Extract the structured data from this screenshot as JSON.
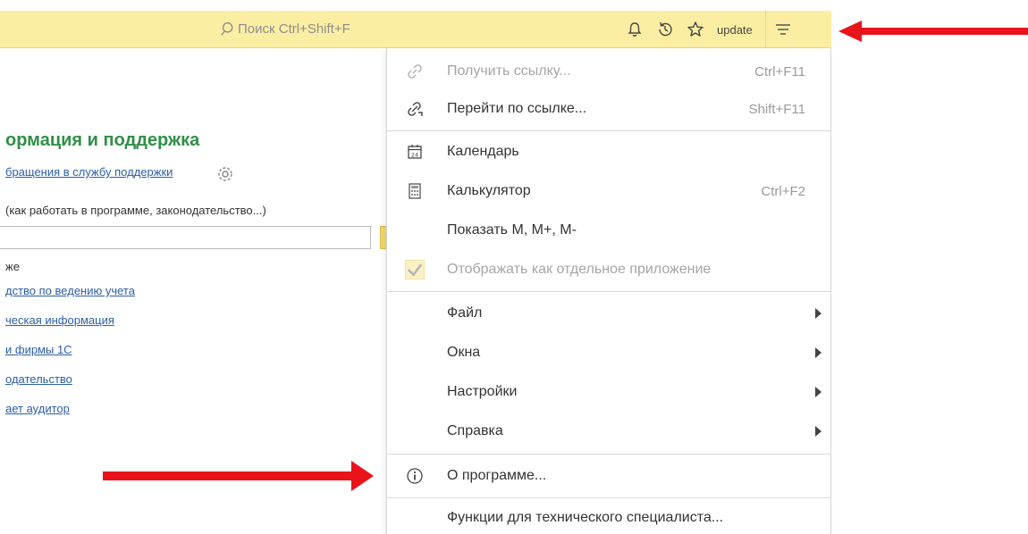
{
  "topbar": {
    "search_placeholder": "Поиск Ctrl+Shift+F",
    "icons": [
      "bell-icon",
      "history-icon",
      "star-icon",
      "menu-icon"
    ],
    "user": "update"
  },
  "page": {
    "title": "ормация и поддержка",
    "support_link": "бращения в службу поддержки",
    "hint": "(как работать в программе, законодательство...)",
    "section_label": "же",
    "links": [
      "дство по ведению учета",
      "ческая информация",
      "и фирмы 1С",
      "одательство",
      "ает аудитор"
    ]
  },
  "menu": {
    "items": [
      {
        "label": "Получить ссылку...",
        "shortcut": "Ctrl+F11",
        "icon": "link-icon",
        "disabled": true
      },
      {
        "label": "Перейти по ссылке...",
        "shortcut": "Shift+F11",
        "icon": "goto-link-icon",
        "disabled": false
      },
      {
        "label": "Календарь",
        "shortcut": "",
        "icon": "calendar-icon",
        "disabled": false
      },
      {
        "label": "Калькулятор",
        "shortcut": "Ctrl+F2",
        "icon": "calculator-icon",
        "disabled": false
      },
      {
        "label": "Показать М, М+, М-",
        "shortcut": "",
        "icon": "",
        "disabled": false
      },
      {
        "label": "Отображать как отдельное приложение",
        "shortcut": "",
        "icon": "check-icon",
        "disabled": true
      },
      {
        "label": "Файл",
        "submenu": true
      },
      {
        "label": "Окна",
        "submenu": true
      },
      {
        "label": "Настройки",
        "submenu": true
      },
      {
        "label": "Справка",
        "submenu": true
      },
      {
        "label": "О программе...",
        "icon": "info-icon"
      },
      {
        "label": "Функции для технического специалиста..."
      }
    ],
    "calendar_day": "24"
  },
  "colors": {
    "topbar_bg": "#fbeea2",
    "title_green": "#2f8f47",
    "link_blue": "#2b5ea7",
    "arrow_red": "#e8131b"
  }
}
